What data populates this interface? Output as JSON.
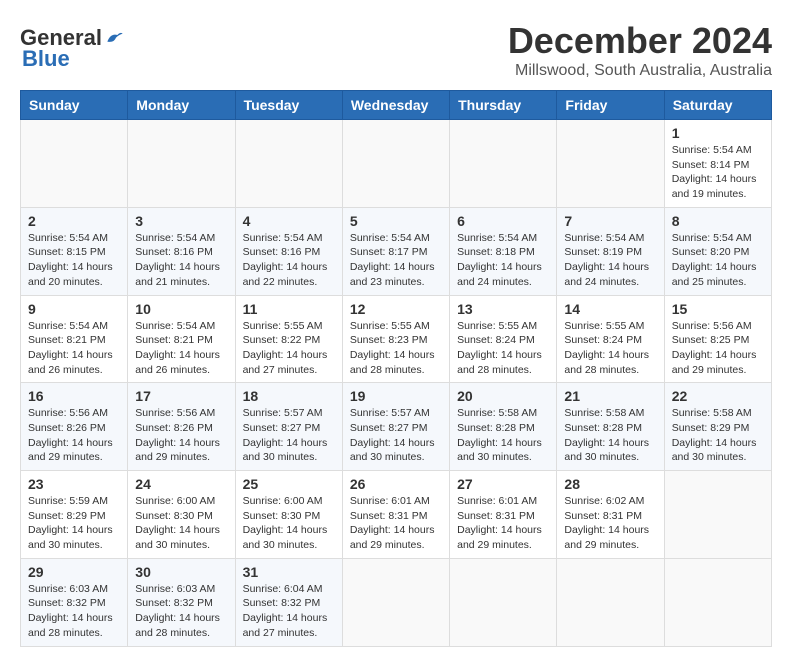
{
  "header": {
    "logo": {
      "general": "General",
      "blue": "Blue"
    },
    "title": "December 2024",
    "subtitle": "Millswood, South Australia, Australia"
  },
  "calendar": {
    "days_of_week": [
      "Sunday",
      "Monday",
      "Tuesday",
      "Wednesday",
      "Thursday",
      "Friday",
      "Saturday"
    ],
    "weeks": [
      [
        null,
        null,
        null,
        null,
        null,
        null,
        null
      ]
    ],
    "cells": [
      {
        "day": null,
        "content": null
      },
      {
        "day": null,
        "content": null
      },
      {
        "day": null,
        "content": null
      },
      {
        "day": null,
        "content": null
      },
      {
        "day": null,
        "content": null
      },
      {
        "day": null,
        "content": null
      },
      {
        "day": null,
        "content": null
      }
    ]
  }
}
